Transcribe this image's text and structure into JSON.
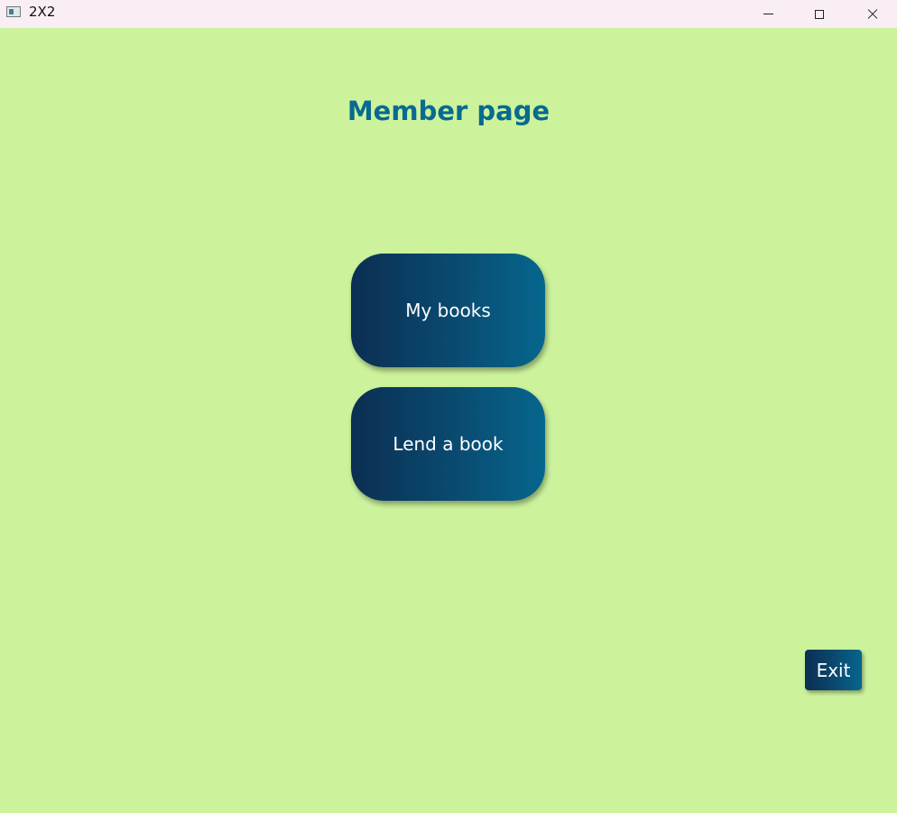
{
  "window": {
    "title": "2X2",
    "controls": {
      "minimize": "minimize-icon",
      "maximize": "maximize-icon",
      "close": "close-icon"
    }
  },
  "page": {
    "title": "Member page",
    "background_color": "#ccf39c",
    "title_color": "#086a8e"
  },
  "buttons": {
    "my_books": "My books",
    "lend_book": "Lend a book",
    "exit": "Exit"
  },
  "button_gradient": [
    "#0b2f52",
    "#0a4b71",
    "#06668d"
  ]
}
